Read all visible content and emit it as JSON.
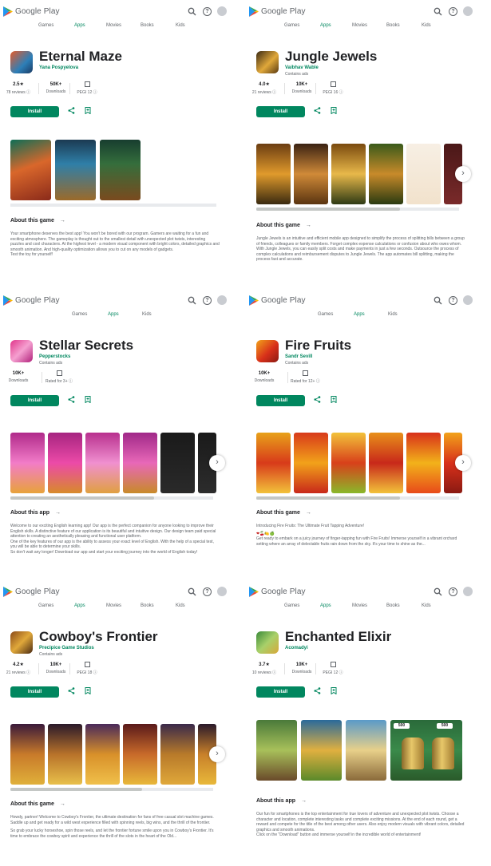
{
  "common": {
    "brand": "Google Play",
    "nav_full": [
      "Games",
      "Apps",
      "Movies",
      "Books",
      "Kids"
    ],
    "nav_short": [
      "Games",
      "Apps",
      "Kids"
    ],
    "active_nav": "Apps",
    "install_label": "Install",
    "accent_color": "#01875f",
    "icons": {
      "search": "search-icon",
      "help": "help-icon",
      "avatar": "account-avatar",
      "share": "share-icon",
      "wishlist": "wishlist-icon",
      "next": "chevron-right-icon",
      "arrow": "arrow-right-icon"
    }
  },
  "panels": [
    {
      "title": "Eternal Maze",
      "developer": "Yana Pospyelova",
      "contains_ads": "",
      "stats": [
        {
          "top": "2.5★",
          "bottom": "78 reviews ⓘ"
        },
        {
          "top": "50K+",
          "bottom": "Downloads"
        },
        {
          "top": "PEGI",
          "bottom": "PEGI 12 ⓘ"
        }
      ],
      "about_heading": "About this game",
      "about_text": [
        "Your smartphone deserves the best app! You won't be bored with our program. Gamers are waiting for a fun and exciting atmosphere. The gameplay is thought out to the smallest detail with unexpected plot twists, interesting puzzles and cool characters. At the highest level - a modern visual component with bright colors, detailed graphics and smooth animation. And high-quality optimization allows you to cut on any models of gadgets.",
        "Test the toy for yourself!"
      ]
    },
    {
      "title": "Jungle Jewels",
      "developer": "Vaibhav Wable",
      "contains_ads": "Contains ads",
      "stats": [
        {
          "top": "4.0★",
          "bottom": "21 reviews ⓘ"
        },
        {
          "top": "10K+",
          "bottom": "Downloads"
        },
        {
          "top": "PEGI",
          "bottom": "PEGI 16 ⓘ"
        }
      ],
      "about_heading": "About this game",
      "about_text": [
        "Jungle Jewels is an intuitive and efficient mobile app designed to simplify the process of splitting bills between a group of friends, colleagues or family members. Forget complex expense calculations or confusion about who owes whom. With Jungle Jewels, you can easily split costs and make payments in just a few seconds. Outsource the process of complex calculations and reimbursement disputes to Jungle Jewels. The app automates bill splitting, making the process fast and accurate."
      ]
    },
    {
      "title": "Stellar Secrets",
      "developer": "Pepperstocks",
      "contains_ads": "Contains ads",
      "stats": [
        {
          "top": "10K+",
          "bottom": "Downloads"
        },
        {
          "top": "3+",
          "bottom": "Rated for 3+ ⓘ"
        }
      ],
      "about_heading": "About this app",
      "about_text": [
        "Welcome to our exciting English learning app! Our app is the perfect companion for anyone looking to improve their English skills. A distinctive feature of our application is its beautiful and intuitive design. Our design team paid special attention to creating an aesthetically pleasing and functional user platform.",
        "One of the key features of our app is the ability to assess your exact level of English. With the help of a special test, you will be able to determine your skills.",
        "So don't wait any longer! Download our app and start your exciting journey into the world of English today!"
      ]
    },
    {
      "title": "Fire Fruits",
      "developer": "Sandr Sevill",
      "contains_ads": "Contains ads",
      "stats": [
        {
          "top": "10K+",
          "bottom": "Downloads"
        },
        {
          "top": "12+",
          "bottom": "Rated for 12+ ⓘ"
        }
      ],
      "about_heading": "About this game",
      "about_text": [
        "Introducing Fire Fruits: The Ultimate Fruit Tapping Adventure!",
        "❤🍒🍋🍏",
        "Get ready to embark on a juicy journey of finger-tapping fun with Fire Fruits! Immerse yourself in a vibrant orchard setting where an array of delectable fruits rain down from the sky. It's your time to shine as the..."
      ]
    },
    {
      "title": "Cowboy's Frontier",
      "developer": "Precipice Game Studios",
      "contains_ads": "Contains ads",
      "stats": [
        {
          "top": "4.2★",
          "bottom": "21 reviews ⓘ"
        },
        {
          "top": "10K+",
          "bottom": "Downloads"
        },
        {
          "top": "PEGI",
          "bottom": "PEGI 18 ⓘ"
        }
      ],
      "about_heading": "About this game",
      "about_text": [
        "Howdy, partner! Welcome to Cowboy's Frontier, the ultimate destination for fans of free casual slot machine games. Saddle up and get ready for a wild west experience filled with spinning reels, big wins, and the thrill of the frontier.",
        "So grab your lucky horseshoe, spin those reels, and let the frontier fortune smile upon you in Cowboy's Frontier. It's time to embrace the cowboy spirit and experience the thrill of the slots in the heart of the Old..."
      ]
    },
    {
      "title": "Enchanted Elixir",
      "developer": "Acomadyi",
      "contains_ads": "",
      "stats": [
        {
          "top": "3.7★",
          "bottom": "10 reviews ⓘ"
        },
        {
          "top": "10K+",
          "bottom": "Downloads"
        },
        {
          "top": "PEGI",
          "bottom": "PEGI 12 ⓘ"
        }
      ],
      "about_heading": "About this app",
      "about_text": [
        "Our fun for smartphones is the top entertainment for true lovers of adventure and unexpected plot twists. Choose a character and location, complete interesting tasks and complete exciting missions. At the end of each round, get a reward and compete for the title of the best among other users. Also enjoy modern visuals with vibrant colors, detailed graphics and smooth animations.",
        "Click on the \"Download\" button and immerse yourself in the incredible world of entertainment!"
      ],
      "screenshot_labels": [
        "500",
        "500"
      ]
    }
  ]
}
